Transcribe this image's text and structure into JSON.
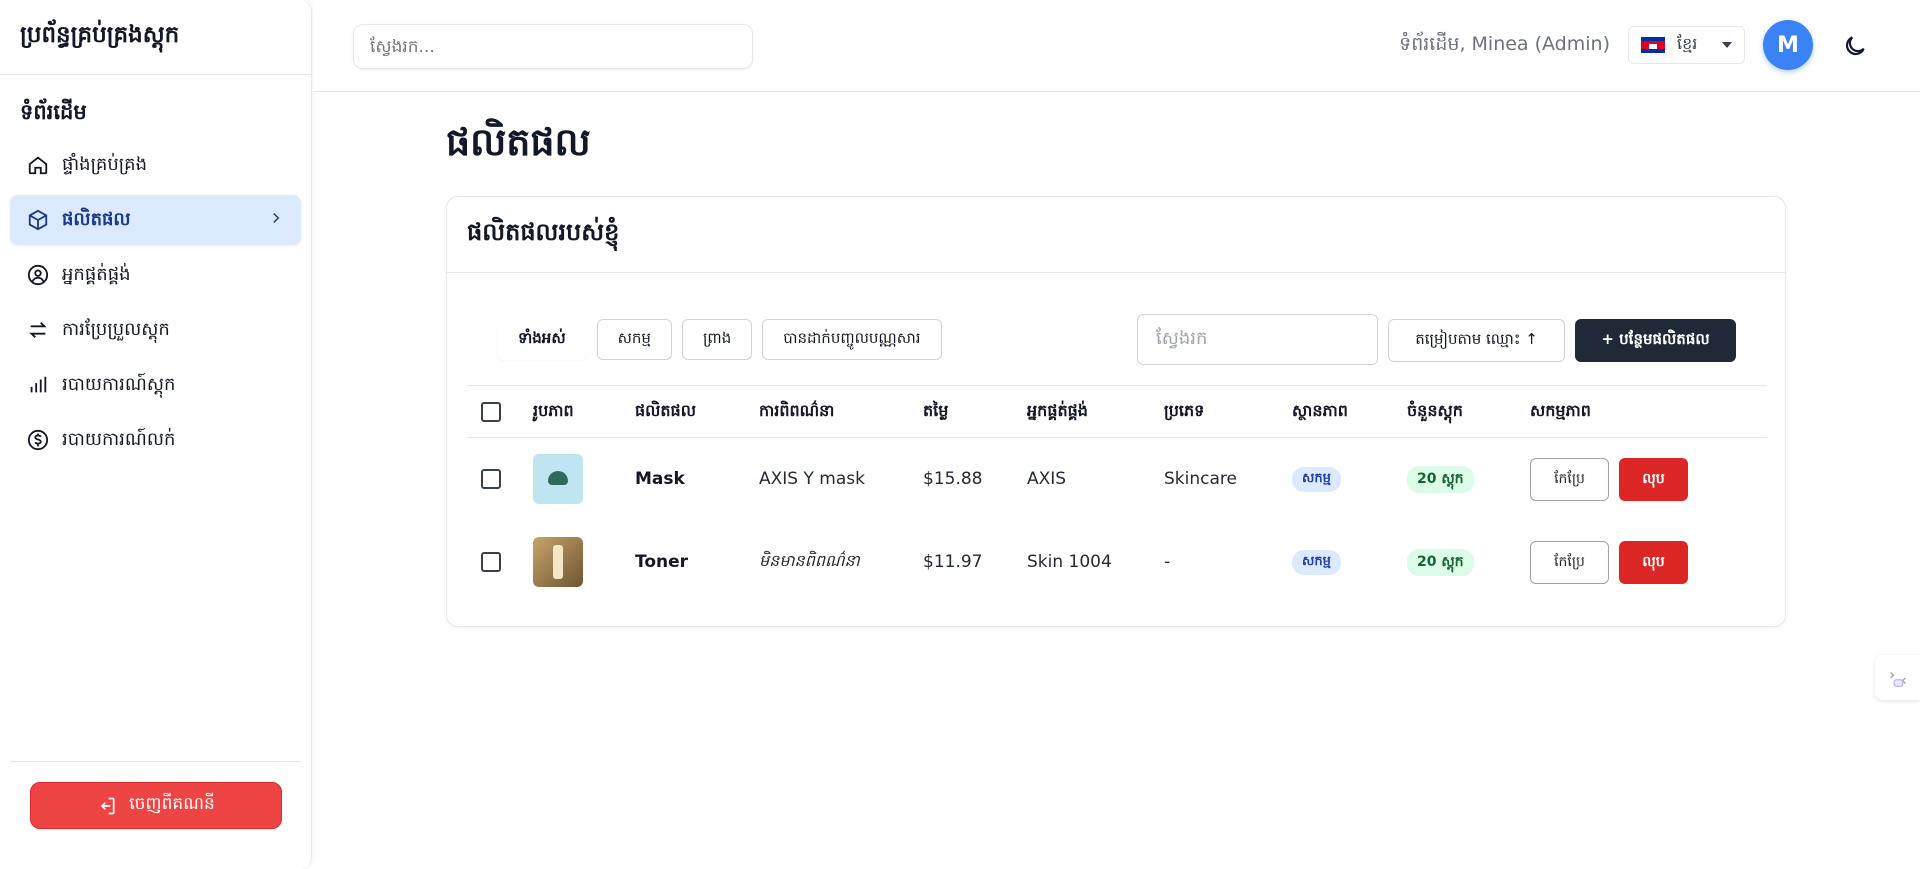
{
  "sidebar": {
    "brand": "ប្រព័ន្ធគ្រប់គ្រងស្តុក",
    "section_title": "ទំព័រដើម",
    "items": [
      {
        "label": "ផ្ទាំងគ្រប់គ្រង",
        "icon": "home-icon"
      },
      {
        "label": "ផលិតផល",
        "icon": "box-icon",
        "active": true
      },
      {
        "label": "អ្នកផ្គត់ផ្គង់",
        "icon": "user-circle-icon"
      },
      {
        "label": "ការប្រែប្រួលស្តុក",
        "icon": "swap-arrows-icon"
      },
      {
        "label": "របាយការណ៍ស្តុក",
        "icon": "bar-chart-icon"
      },
      {
        "label": "របាយការណ៍លក់",
        "icon": "dollar-circle-icon"
      }
    ],
    "logout_label": "ចេញពីគណនី"
  },
  "topbar": {
    "search_placeholder": "ស្វែងរក...",
    "welcome": "ទំព័រដើម, Minea (Admin)",
    "language": "ខ្មែរ",
    "avatar_initial": "M"
  },
  "main": {
    "page_title": "ផលិតផល",
    "card_title": "ផលិតផលរបស់ខ្ញុំ",
    "filters": [
      "ទាំងអស់",
      "សកម្ម",
      "ព្រាង",
      "បានដាក់បញ្ចូលបណ្ណសារ"
    ],
    "search_placeholder": "ស្វែងរក",
    "sort_label": "តម្រៀបតាម ឈ្មោះ ↑",
    "add_label": "+ បន្ថែមផលិតផល",
    "columns": [
      "រូបភាព",
      "ផលិតផល",
      "ការពិពណ៌នា",
      "តម្លៃ",
      "អ្នកផ្គត់ផ្គង់",
      "ប្រភេទ",
      "ស្ថានភាព",
      "ចំនួនស្តុក",
      "សកម្មភាព"
    ],
    "rows": [
      {
        "name": "Mask",
        "description": "AXIS Y mask",
        "price": "$15.88",
        "supplier": "AXIS",
        "category": "Skincare",
        "status": "សកម្ម",
        "stock": "20 ស្តុក",
        "edit": "កែប្រែ",
        "delete": "លុប"
      },
      {
        "name": "Toner",
        "description": "មិនមានពិពណ៌នា",
        "price": "$11.97",
        "supplier": "Skin 1004",
        "category": "-",
        "status": "សកម្ម",
        "stock": "20 ស្តុក",
        "edit": "កែប្រែ",
        "delete": "លុប"
      }
    ]
  },
  "colors": {
    "accent": "#3b82f6",
    "danger": "#dc2626",
    "active_nav_bg": "#dbeafe",
    "primary_button": "#1f2937"
  }
}
